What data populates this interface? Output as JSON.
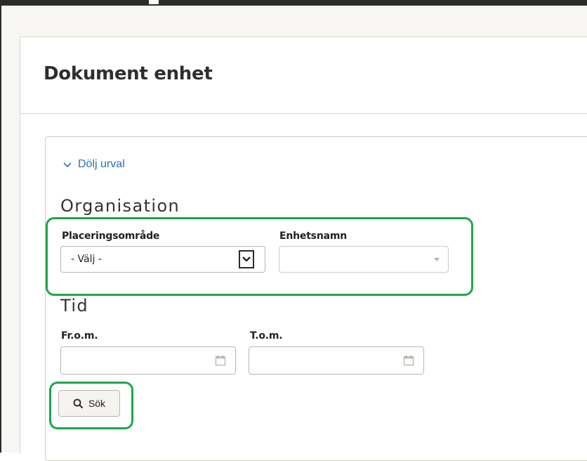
{
  "page": {
    "title": "Dokument enhet"
  },
  "filter": {
    "toggle_label": "Dölj urval",
    "toggle_icon": "chevron-down-icon",
    "accent_color": "#2a72b8",
    "organisation": {
      "heading": "Organisation",
      "placering": {
        "label": "Placeringsområde",
        "selected": "- Välj -"
      },
      "enhetsnamn": {
        "label": "Enhetsnamn",
        "selected": ""
      }
    },
    "tid": {
      "heading": "Tid",
      "from": {
        "label": "Fr.o.m.",
        "value": "",
        "icon": "calendar-icon"
      },
      "to": {
        "label": "T.o.m.",
        "value": "",
        "icon": "calendar-icon"
      }
    },
    "search_button": {
      "label": "Sök",
      "icon": "search-icon"
    }
  },
  "highlight_color": "#1fa64a"
}
